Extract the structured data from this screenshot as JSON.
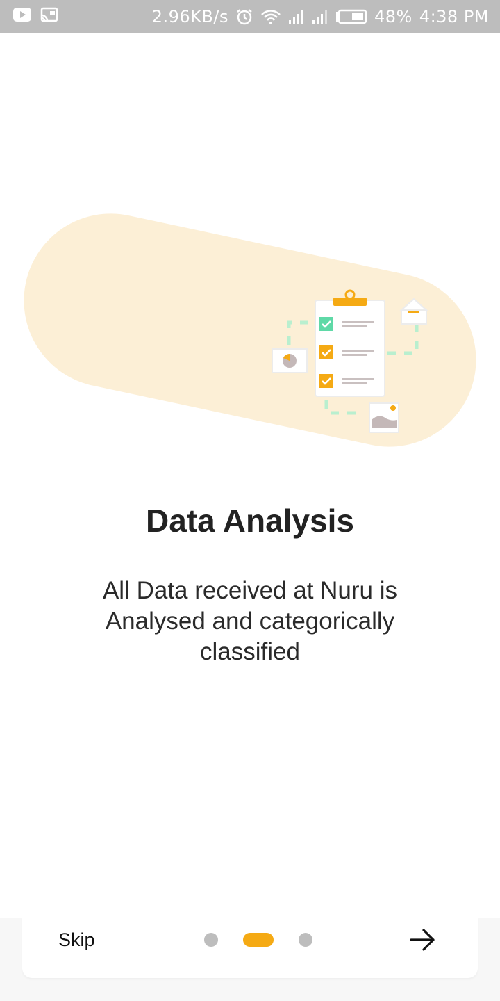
{
  "status_bar": {
    "icons_left": [
      "youtube-icon",
      "cast-icon"
    ],
    "network_speed": "2.96KB/s",
    "battery_percent": "48%",
    "time": "4:38 PM",
    "icons_right": [
      "alarm-icon",
      "wifi-icon",
      "signal-icon",
      "signal-icon",
      "battery-icon"
    ]
  },
  "onboarding": {
    "title": "Data Analysis",
    "description": "All Data received at Nuru is Analysed and categorically classified",
    "current_page": 2,
    "total_pages": 3
  },
  "nav": {
    "skip_label": "Skip",
    "next_icon": "arrow-right-icon"
  },
  "colors": {
    "accent": "#f5aa14",
    "blob": "#fcefd6",
    "inactive_dot": "#bdbdbd",
    "check_green": "#5fd9a7",
    "dashed_line": "#b9efcf",
    "status_bar": "#bdbdbd"
  }
}
